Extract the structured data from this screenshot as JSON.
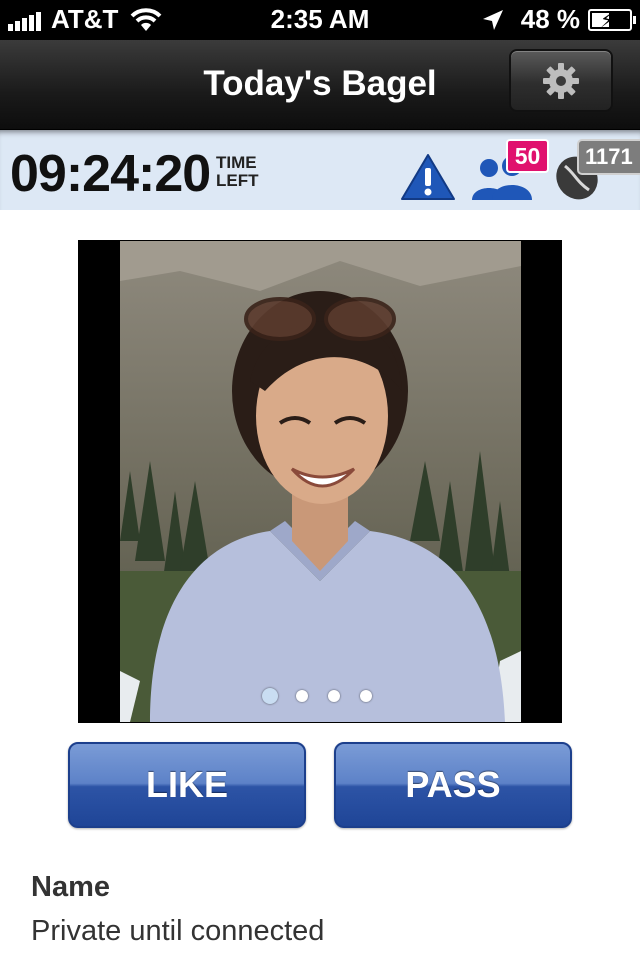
{
  "status_bar": {
    "carrier": "AT&T",
    "time": "2:35 AM",
    "battery_percent": "48 %",
    "battery_level": 0.48
  },
  "nav": {
    "title": "Today's Bagel",
    "settings_icon": "gear-icon"
  },
  "timer": {
    "value": "09:24:20",
    "label_line1": "TIME",
    "label_line2": "LEFT"
  },
  "counters": {
    "connections_badge": "50",
    "beans": "1171"
  },
  "photo": {
    "page_count": 4,
    "current_page": 1
  },
  "actions": {
    "like_label": "LIKE",
    "pass_label": "PASS"
  },
  "profile": {
    "name_label": "Name",
    "name_value": "Private until connected"
  },
  "colors": {
    "accent_blue": "#2d54a6",
    "badge_pink": "#e0116e",
    "timer_strip": "#dde8f5"
  }
}
